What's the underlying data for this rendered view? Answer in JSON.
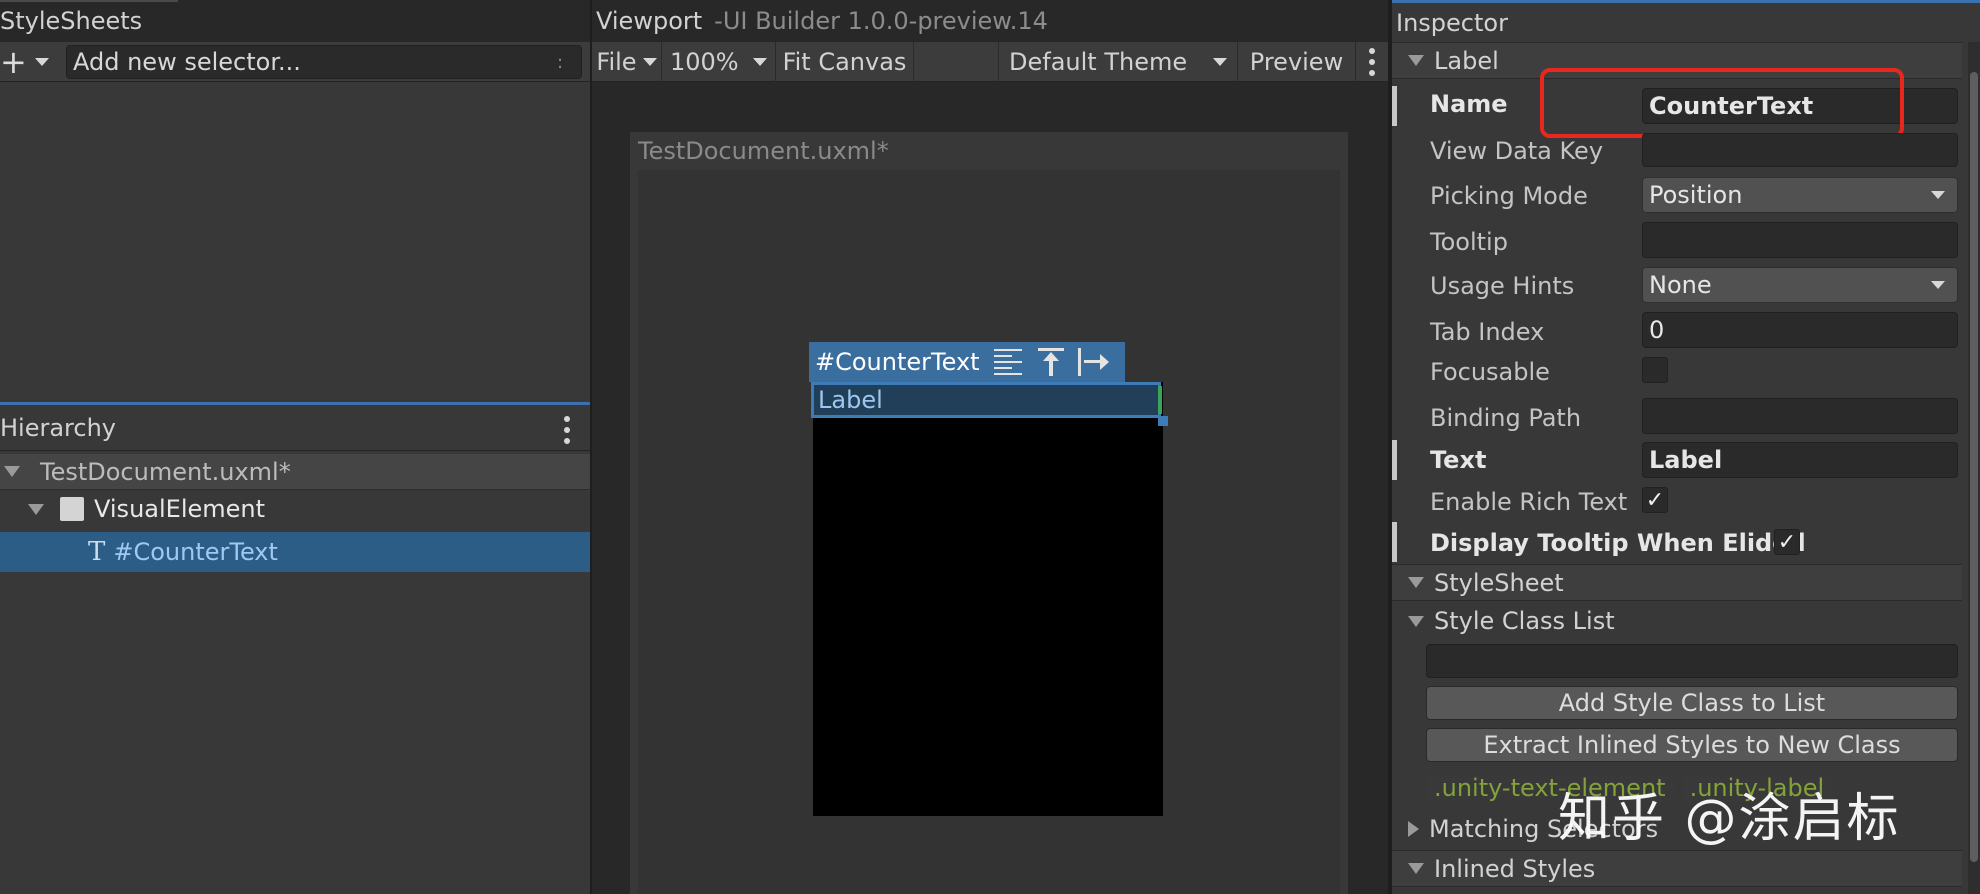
{
  "stylesheets": {
    "title": "StyleSheets",
    "add_selector_placeholder": "Add new selector...",
    "options_glyph": ":"
  },
  "hierarchy": {
    "title": "Hierarchy",
    "items": [
      {
        "label": "TestDocument.uxml*"
      },
      {
        "label": "VisualElement"
      },
      {
        "label": "#CounterText"
      }
    ]
  },
  "viewport": {
    "title": "Viewport",
    "subtitle": "-UI Builder 1.0.0-preview.14",
    "file_menu": "File",
    "zoom": "100%",
    "fit_canvas": "Fit Canvas",
    "theme": "Default Theme",
    "preview": "Preview",
    "canvas_title": "TestDocument.uxml*",
    "selection_name": "#CounterText",
    "label_text": "Label"
  },
  "inspector": {
    "title": "Inspector",
    "section_label": "Label",
    "fields": {
      "name_label": "Name",
      "name_value": "CounterText",
      "view_data_key_label": "View Data Key",
      "view_data_key_value": "",
      "picking_mode_label": "Picking Mode",
      "picking_mode_value": "Position",
      "tooltip_label": "Tooltip",
      "tooltip_value": "",
      "usage_hints_label": "Usage Hints",
      "usage_hints_value": "None",
      "tab_index_label": "Tab Index",
      "tab_index_value": "0",
      "focusable_label": "Focusable",
      "binding_path_label": "Binding Path",
      "binding_path_value": "",
      "text_label": "Text",
      "text_value": "Label",
      "enable_rich_text_label": "Enable Rich Text",
      "display_tooltip_label": "Display Tooltip When Elided"
    },
    "checkbox_glyph": "✓",
    "stylesheet_section": "StyleSheet",
    "style_class_list": "Style Class List",
    "add_class_button": "Add Style Class to List",
    "extract_button": "Extract Inlined Styles to New Class",
    "classes": [
      ".unity-text-element",
      ".unity-label"
    ],
    "matching_selectors": "Matching Selectors",
    "inlined_styles": "Inlined Styles"
  },
  "watermark": "知乎 @涂启标",
  "colors": {
    "selection_blue": "#2c5d87",
    "highlight_red": "#e8281e",
    "class_tag_green": "#84a23a"
  }
}
